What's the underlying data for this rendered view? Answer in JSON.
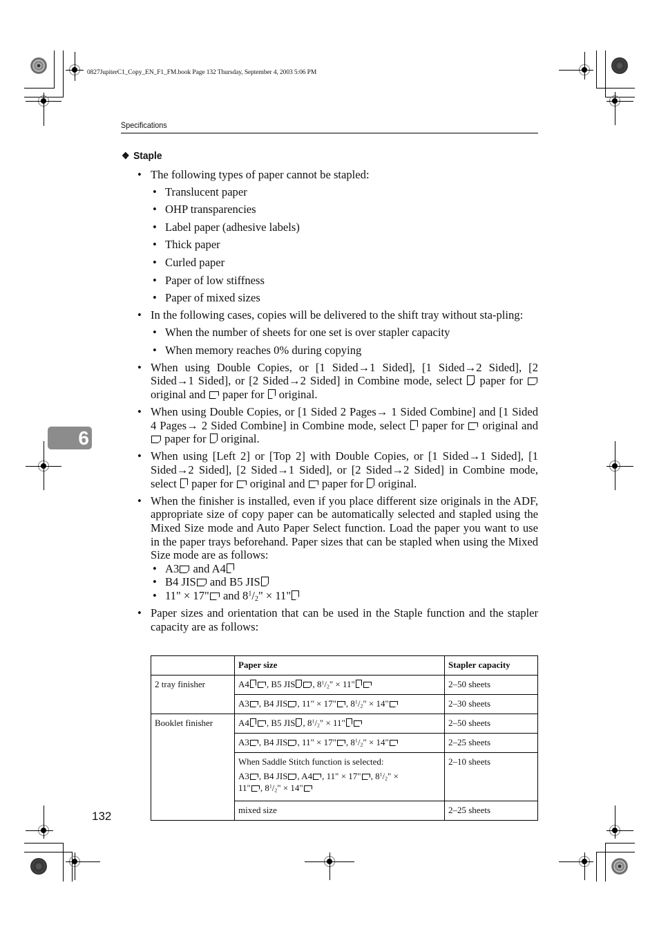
{
  "book_info": "0827JupiterC1_Copy_EN_F1_FM.book  Page 132  Thursday, September 4, 2003  5:06 PM",
  "running_head": "Specifications",
  "chapter_tab": "6",
  "page_number": "132",
  "section": {
    "icon": "diamond-bullet-icon",
    "title": "Staple"
  },
  "bullets": {
    "b1": {
      "text": "The following types of paper cannot be stapled:",
      "items": [
        "Translucent paper",
        "OHP transparencies",
        "Label paper (adhesive labels)",
        "Thick paper",
        "Curled paper",
        "Paper of low stiffness",
        "Paper of mixed sizes"
      ]
    },
    "b2": {
      "text": "In the following cases, copies will be delivered to the shift tray without sta-pling:",
      "items": [
        "When the number of sheets for one set is over stapler capacity",
        "When memory reaches 0% during copying"
      ]
    },
    "b3": {
      "p1": "When using Double Copies, or [1 Sided→1 Sided], [1 Sided→2 Sided], [2 Sided→1 Sided], or [2 Sided→2 Sided] in Combine mode, select",
      "p2": "paper for",
      "p3": "original and",
      "p4": "paper for",
      "p5": "original."
    },
    "b4": {
      "p1": "When using Double Copies, or [1 Sided 2 Pages→ 1 Sided Combine] and [1 Sided 4 Pages→ 2 Sided Combine] in Combine mode, select",
      "p2": "paper for",
      "p3": "original and",
      "p4": "paper for",
      "p5": "original."
    },
    "b5": {
      "p1": "When using [Left 2] or [Top 2] with Double Copies, or [1 Sided→1 Sided], [1 Sided→2 Sided], [2 Sided→1 Sided], or [2 Sided→2 Sided] in Combine mode, select",
      "p2": "paper for",
      "p3": "original and",
      "p4": "paper for",
      "p5": "original."
    },
    "b6": {
      "text": "When the finisher is installed, even if you place different size originals in the ADF, appropriate size of copy paper can be automatically selected and stapled using the Mixed Size mode and Auto Paper Select function. Load the paper you want to use in the paper trays beforehand. Paper sizes that can be stapled when using the Mixed Size mode are as follows:",
      "items": [
        {
          "a": "A3",
          "and": "and A4"
        },
        {
          "a": "B4 JIS",
          "and": "and B5 JIS"
        },
        {
          "a": "11\" × 17\"",
          "and": "and 8",
          "sup": "1",
          "slash": "/",
          "sub": "2",
          "rest": "\" × 11\""
        }
      ]
    },
    "b7": {
      "text": "Paper sizes and orientation that can be used in the Staple function and the stapler capacity are as follows:"
    }
  },
  "table": {
    "headers": [
      "",
      "Paper size",
      "Stapler capacity"
    ],
    "groups": [
      {
        "label": "2 tray finisher",
        "rows": [
          {
            "paper": "A4 (portrait, landscape), B5 JIS (portrait, landscape), 8 1/2\" × 11\" (portrait, landscape)",
            "capacity": "2–50 sheets"
          },
          {
            "paper": "A3 (landscape), B4 JIS (landscape), 11\" × 17\" (landscape), 8 1/2\" × 14\" (landscape)",
            "capacity": "2–30 sheets"
          }
        ]
      },
      {
        "label": "Booklet finisher",
        "rows": [
          {
            "paper": "A4 (portrait, landscape), B5 JIS (portrait), 8 1/2\" × 11\" (portrait, landscape)",
            "capacity": "2–50 sheets"
          },
          {
            "paper": "A3 (landscape), B4 JIS (landscape), 11\" × 17\" (landscape), 8 1/2\" × 14\" (landscape)",
            "capacity": "2–25 sheets"
          },
          {
            "paper_note": "When Saddle Stitch function is selected:",
            "paper": "A3 (landscape), B4 JIS (landscape), A4 (landscape), 11\" × 17\" (landscape), 8 1/2\" × 11\" (landscape), 8 1/2\" × 14\" (landscape)",
            "capacity": "2–10 sheets"
          },
          {
            "paper": "mixed size",
            "capacity": "2–25 sheets"
          }
        ]
      }
    ],
    "labels": {
      "a4": "A4",
      "b5jis": "B5 JIS",
      "eight": "8",
      "one": "1",
      "two": "2",
      "slash": "/",
      "x11": "\" × 11\"",
      "x14": "\" × 14\"",
      "a3": "A3",
      "b4jis": "B4 JIS",
      "x17": "11\" × 17\"",
      "comma": ", ",
      "xbreak": "\" ×",
      "eleven": "11\""
    }
  }
}
